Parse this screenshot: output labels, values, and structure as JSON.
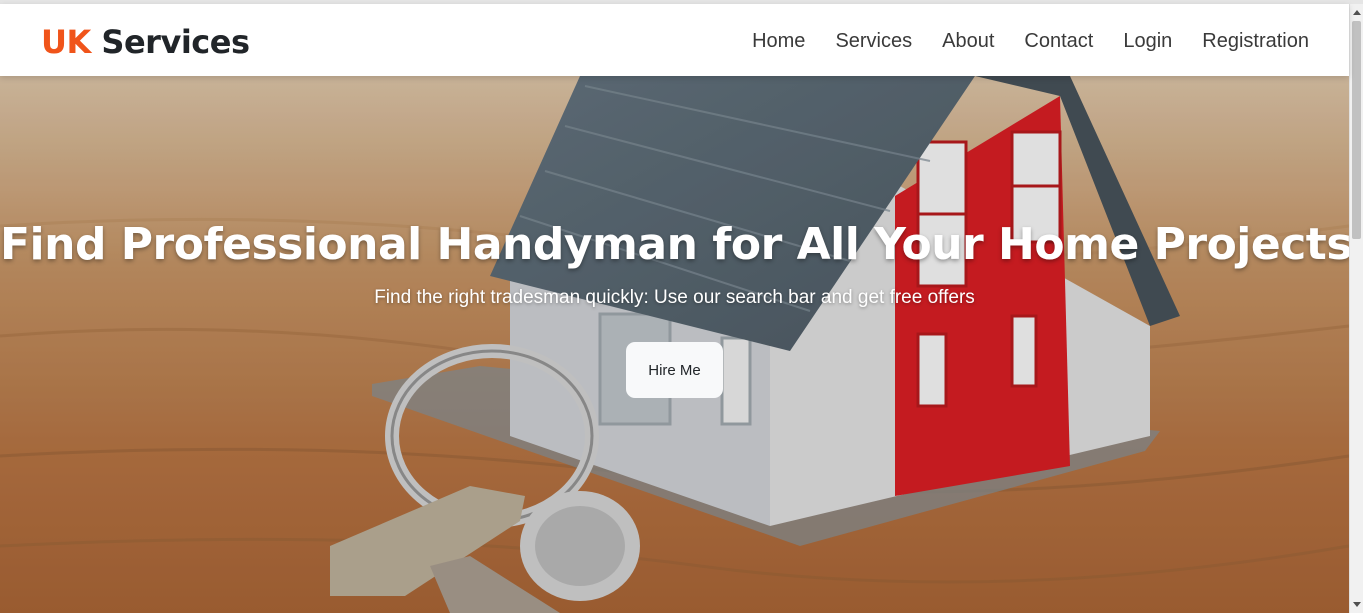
{
  "brand": {
    "accent_text": "UK",
    "main_text": "Services",
    "accent_color": "#f0541a"
  },
  "nav": {
    "items": [
      {
        "label": "Home"
      },
      {
        "label": "Services"
      },
      {
        "label": "About"
      },
      {
        "label": "Contact"
      },
      {
        "label": "Login"
      },
      {
        "label": "Registration"
      }
    ]
  },
  "hero": {
    "title": "Find Professional Handyman for All Your Home Projects",
    "subtitle": "Find the right tradesman quickly: Use our search bar and get free offers",
    "cta_label": "Hire Me",
    "image_subject": "house-model-with-keys"
  }
}
